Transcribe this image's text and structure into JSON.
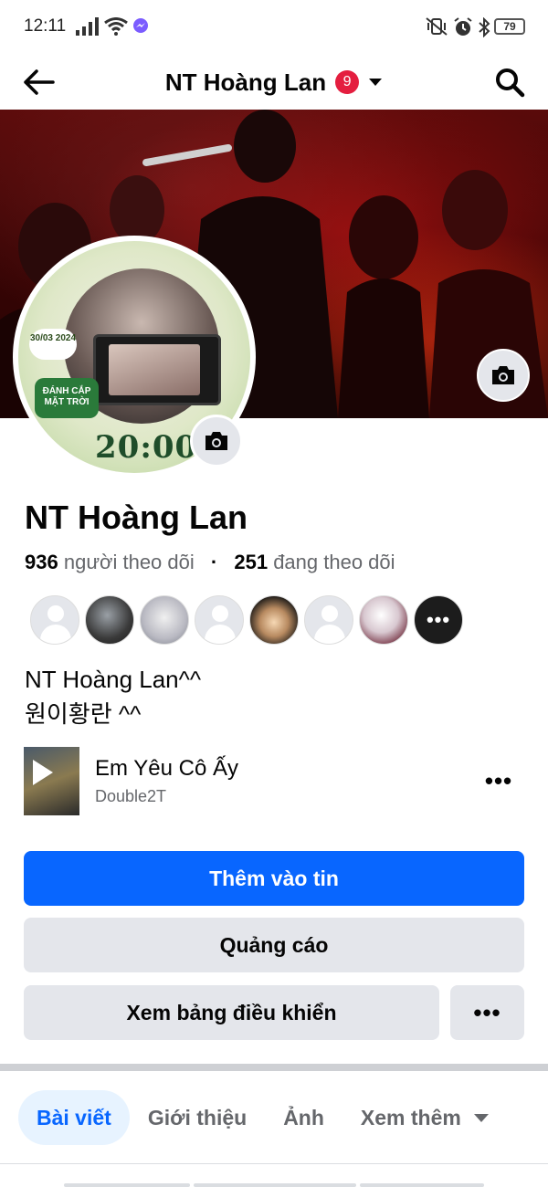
{
  "status_bar": {
    "time": "12:11",
    "battery": "79"
  },
  "header": {
    "title": "NT Hoàng Lan",
    "badge_count": "9"
  },
  "avatar": {
    "date_text": "30/03 2024",
    "event_text": "ĐÁNH CẮP MẶT TRỜI",
    "clock_text": "20:00"
  },
  "profile": {
    "name": "NT Hoàng Lan",
    "followers_count": "936",
    "followers_label": "người theo dõi",
    "following_count": "251",
    "following_label": "đang theo dõi",
    "more_followers": "•••",
    "bio_line1": "NT Hoàng Lan^^",
    "bio_line2": "원이황란 ^^"
  },
  "music": {
    "title": "Em Yêu Cô Ấy",
    "artist": "Double2T",
    "more": "•••"
  },
  "buttons": {
    "add_to_story": "Thêm vào tin",
    "ads": "Quảng cáo",
    "dashboard": "Xem bảng điều khiển",
    "more": "•••"
  },
  "tabs": [
    {
      "label": "Bài viết",
      "active": true
    },
    {
      "label": "Giới thiệu",
      "active": false
    },
    {
      "label": "Ảnh",
      "active": false
    },
    {
      "label": "Xem thêm",
      "active": false
    }
  ],
  "colors": {
    "primary": "#0866ff",
    "badge": "#e41e3f",
    "secondary_button": "#e4e6eb",
    "muted_text": "#65676b",
    "active_tab_bg": "#e7f3ff"
  },
  "icons": [
    "back-arrow-icon",
    "chevron-down-icon",
    "search-icon",
    "camera-icon",
    "play-icon",
    "more-dots-icon",
    "signal-icon",
    "wifi-icon",
    "messenger-icon",
    "vibrate-icon",
    "alarm-icon",
    "bluetooth-icon",
    "battery-icon"
  ]
}
